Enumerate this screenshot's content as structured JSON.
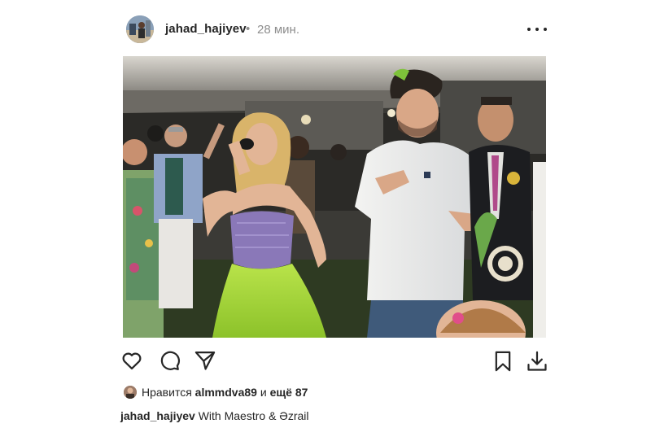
{
  "post": {
    "username": "jahad_hajiyev",
    "separator": "•",
    "time_ago": "28 мин.",
    "more_icon": "more-horizontal-icon"
  },
  "photo": {
    "alt": "Photo of people dancing at a party"
  },
  "actions": {
    "like_icon": "heart-icon",
    "comment_icon": "comment-bubble-icon",
    "share_icon": "paper-plane-icon",
    "save_icon": "bookmark-icon",
    "download_icon": "download-icon"
  },
  "likes": {
    "prefix": "Нравится",
    "user": "almmdva89",
    "middle": "и",
    "rest": "ещё 87"
  },
  "caption": {
    "username": "jahad_hajiyev",
    "text": "With Maestro & Əzrail"
  },
  "colors": {
    "text": "#262626",
    "muted": "#8e8e8e",
    "background": "#ffffff"
  }
}
